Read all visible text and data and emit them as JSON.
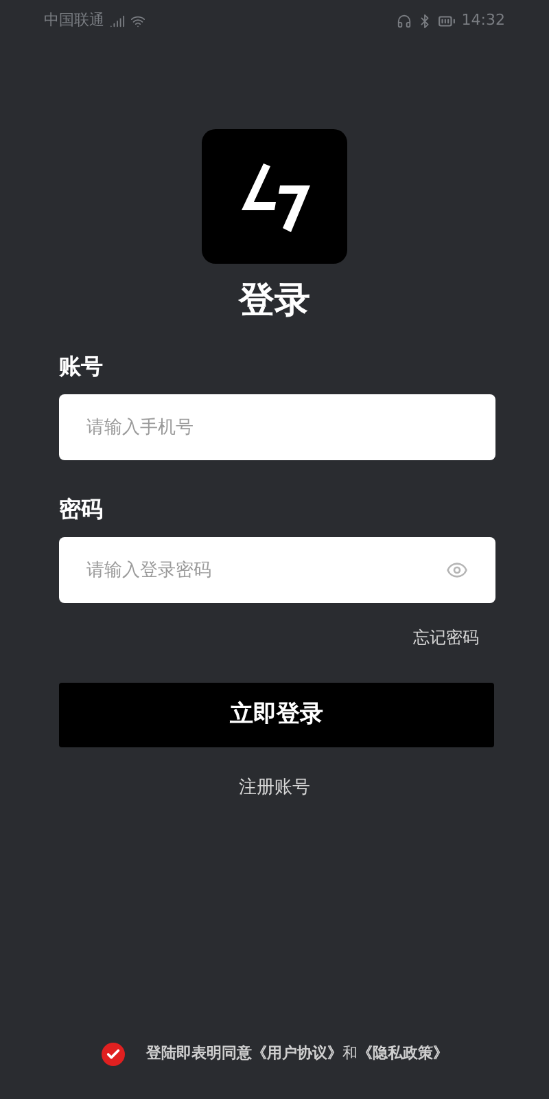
{
  "status_bar": {
    "carrier": "中国联通",
    "time": "14:32"
  },
  "title": "登录",
  "fields": [
    {
      "label": "账号",
      "placeholder": "请输入手机号",
      "kind": "text"
    },
    {
      "label": "密码",
      "placeholder": "请输入登录密码",
      "kind": "password"
    }
  ],
  "forgot_link": "忘记密码",
  "login_button": "立即登录",
  "register_link": "注册账号",
  "agreement": {
    "checked": true,
    "text": "登陆即表明同意",
    "user_agreement": "《用户协议》",
    "conjunction": "和",
    "privacy_policy": "《隐私政策》"
  }
}
